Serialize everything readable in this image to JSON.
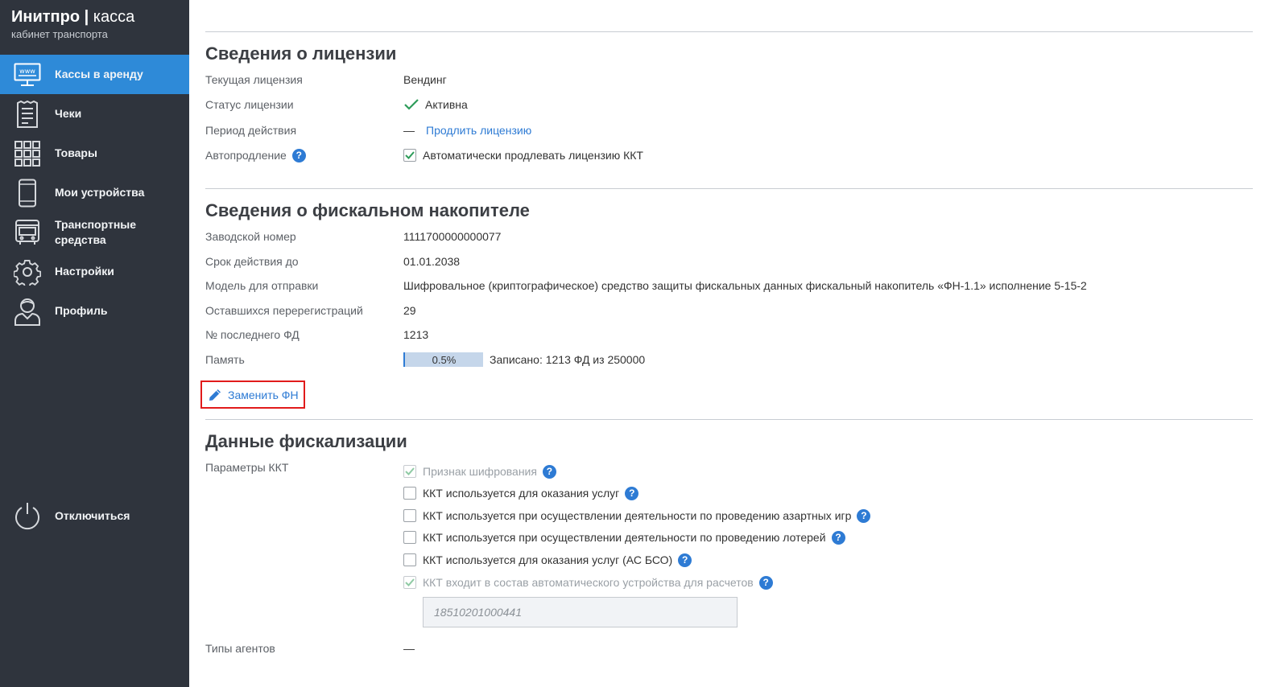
{
  "brand": {
    "name": "Инитпро",
    "separator": "|",
    "product": "касса",
    "subtitle": "кабинет транспорта"
  },
  "sidebar": {
    "items": [
      {
        "label": "Кассы в аренду",
        "icon": "www-monitor-icon",
        "active": true
      },
      {
        "label": "Чеки",
        "icon": "receipt-icon"
      },
      {
        "label": "Товары",
        "icon": "grid-icon"
      },
      {
        "label": "Мои устройства",
        "icon": "smartphone-icon"
      },
      {
        "label": "Транспортные средства",
        "icon": "bus-icon"
      },
      {
        "label": "Настройки",
        "icon": "gear-icon"
      },
      {
        "label": "Профиль",
        "icon": "user-icon"
      }
    ],
    "logout": {
      "label": "Отключиться",
      "icon": "power-icon"
    }
  },
  "license": {
    "title": "Сведения о лицензии",
    "current_label": "Текущая лицензия",
    "current_value": "Вендинг",
    "status_label": "Статус лицензии",
    "status_value": "Активна",
    "period_label": "Период действия",
    "period_value": "—",
    "extend_link": "Продлить лицензию",
    "auto_label": "Автопродление",
    "auto_checkbox": "Автоматически продлевать лицензию ККТ",
    "auto_checked": true
  },
  "fn": {
    "title": "Сведения о фискальном накопителе",
    "serial_label": "Заводской номер",
    "serial_value": "1111700000000077",
    "expiry_label": "Срок действия до",
    "expiry_value": "01.01.2038",
    "model_label": "Модель для отправки",
    "model_value": "Шифровальное (криптографическое) средство защиты фискальных данных фискальный накопитель «ФН-1.1» исполнение 5-15-2",
    "rereg_label": "Оставшихся перерегистраций",
    "rereg_value": "29",
    "last_fd_label": "№ последнего ФД",
    "last_fd_value": "1213",
    "memory_label": "Память",
    "memory_percent": "0.5%",
    "memory_fraction": 0.005,
    "memory_text": "Записано: 1213 ФД из 250000",
    "replace_button": "Заменить ФН"
  },
  "fiscal": {
    "title": "Данные фискализации",
    "params_label": "Параметры ККТ",
    "options": [
      {
        "label": "Признак шифрования",
        "checked": true,
        "disabled": true
      },
      {
        "label": "ККТ используется для оказания услуг",
        "checked": false,
        "disabled": false
      },
      {
        "label": "ККТ используется при осуществлении деятельности по проведению азартных игр",
        "checked": false,
        "disabled": false
      },
      {
        "label": "ККТ используется при осуществлении деятельности по проведению лотерей",
        "checked": false,
        "disabled": false
      },
      {
        "label": "ККТ используется для оказания услуг (АС БСО)",
        "checked": false,
        "disabled": false
      },
      {
        "label": "ККТ входит в состав автоматического устройства для расчетов",
        "checked": true,
        "disabled": true
      }
    ],
    "device_number": "18510201000441",
    "agents_label": "Типы агентов",
    "agents_value": "—",
    "help_symbol": "?"
  },
  "colors": {
    "sidebar": "#2f343d",
    "accent": "#2e8ad8",
    "link": "#2e7bd4",
    "highlight": "#e11b1b",
    "check": "#2e9c5a"
  }
}
